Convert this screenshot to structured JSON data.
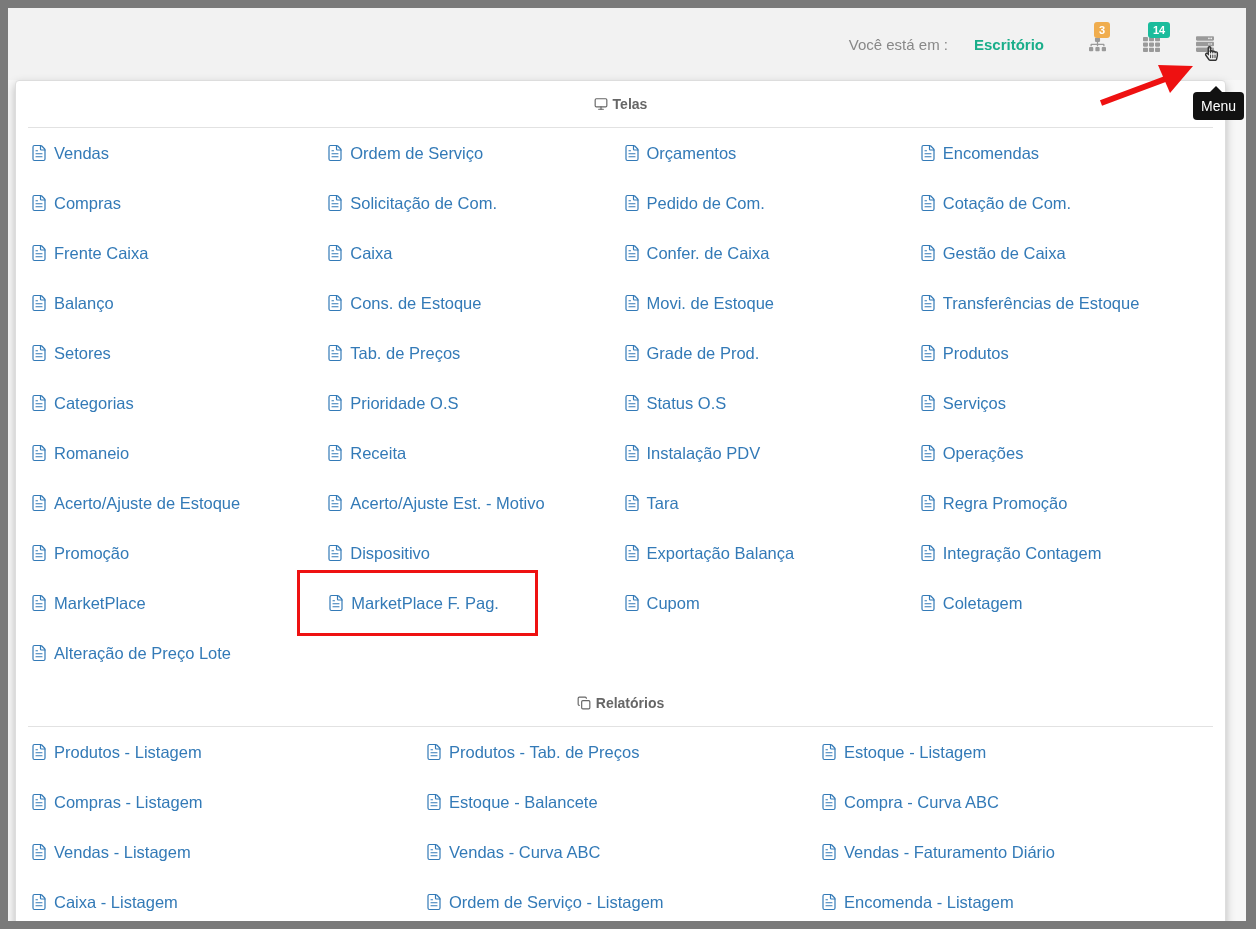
{
  "header": {
    "location_label": "Você está em :",
    "location_value": "Escritório",
    "icons": [
      {
        "kind": "sitemap",
        "badge": "3",
        "color": "#f0ad4e"
      },
      {
        "kind": "grid",
        "badge": "14",
        "color": "#1abc9c"
      },
      {
        "kind": "menu"
      }
    ],
    "tooltip": "Menu"
  },
  "menu": {
    "sections": [
      {
        "title": "Telas",
        "kind": "screens",
        "items": [
          {
            "label": "Vendas",
            "highlighted": false
          },
          {
            "label": "Ordem de Serviço",
            "highlighted": false
          },
          {
            "label": "Orçamentos",
            "highlighted": false
          },
          {
            "label": "Encomendas",
            "highlighted": false
          },
          {
            "label": "Compras",
            "highlighted": false
          },
          {
            "label": "Solicitação de Com.",
            "highlighted": false
          },
          {
            "label": "Pedido de Com.",
            "highlighted": false
          },
          {
            "label": "Cotação de Com.",
            "highlighted": false
          },
          {
            "label": "Frente Caixa",
            "highlighted": false
          },
          {
            "label": "Caixa",
            "highlighted": false
          },
          {
            "label": "Confer. de Caixa",
            "highlighted": false
          },
          {
            "label": "Gestão de Caixa",
            "highlighted": false
          },
          {
            "label": "Balanço",
            "highlighted": false
          },
          {
            "label": "Cons. de Estoque",
            "highlighted": false
          },
          {
            "label": "Movi. de Estoque",
            "highlighted": false
          },
          {
            "label": "Transferências de Estoque",
            "highlighted": false
          },
          {
            "label": "Setores",
            "highlighted": false
          },
          {
            "label": "Tab. de Preços",
            "highlighted": false
          },
          {
            "label": "Grade de Prod.",
            "highlighted": false
          },
          {
            "label": "Produtos",
            "highlighted": false
          },
          {
            "label": "Categorias",
            "highlighted": false
          },
          {
            "label": "Prioridade O.S",
            "highlighted": false
          },
          {
            "label": "Status O.S",
            "highlighted": false
          },
          {
            "label": "Serviços",
            "highlighted": false
          },
          {
            "label": "Romaneio",
            "highlighted": false
          },
          {
            "label": "Receita",
            "highlighted": false
          },
          {
            "label": "Instalação PDV",
            "highlighted": false
          },
          {
            "label": "Operações",
            "highlighted": false
          },
          {
            "label": "Acerto/Ajuste de Estoque",
            "highlighted": false
          },
          {
            "label": "Acerto/Ajuste Est. - Motivo",
            "highlighted": false
          },
          {
            "label": "Tara",
            "highlighted": false
          },
          {
            "label": "Regra Promoção",
            "highlighted": false
          },
          {
            "label": "Promoção",
            "highlighted": false
          },
          {
            "label": "Dispositivo",
            "highlighted": false
          },
          {
            "label": "Exportação Balança",
            "highlighted": false
          },
          {
            "label": "Integração Contagem",
            "highlighted": false
          },
          {
            "label": "MarketPlace",
            "highlighted": false
          },
          {
            "label": "MarketPlace F. Pag.",
            "highlighted": true
          },
          {
            "label": "Cupom",
            "highlighted": false
          },
          {
            "label": "Coletagem",
            "highlighted": false
          },
          {
            "label": "Alteração de Preço Lote",
            "highlighted": false
          }
        ]
      },
      {
        "title": "Relatórios",
        "kind": "reports",
        "items": [
          {
            "label": "Produtos - Listagem",
            "highlighted": false
          },
          {
            "label": "Produtos - Tab. de Preços",
            "highlighted": false
          },
          {
            "label": "Estoque - Listagem",
            "highlighted": false
          },
          {
            "label": "Compras - Listagem",
            "highlighted": false
          },
          {
            "label": "Estoque - Balancete",
            "highlighted": false
          },
          {
            "label": "Compra - Curva ABC",
            "highlighted": false
          },
          {
            "label": "Vendas - Listagem",
            "highlighted": false
          },
          {
            "label": "Vendas - Curva ABC",
            "highlighted": false
          },
          {
            "label": "Vendas - Faturamento Diário",
            "highlighted": false
          },
          {
            "label": "Caixa - Listagem",
            "highlighted": false
          },
          {
            "label": "Ordem de Serviço - Listagem",
            "highlighted": false
          },
          {
            "label": "Encomenda - Listagem",
            "highlighted": false
          }
        ]
      }
    ]
  },
  "annotation": {
    "arrow": true
  }
}
